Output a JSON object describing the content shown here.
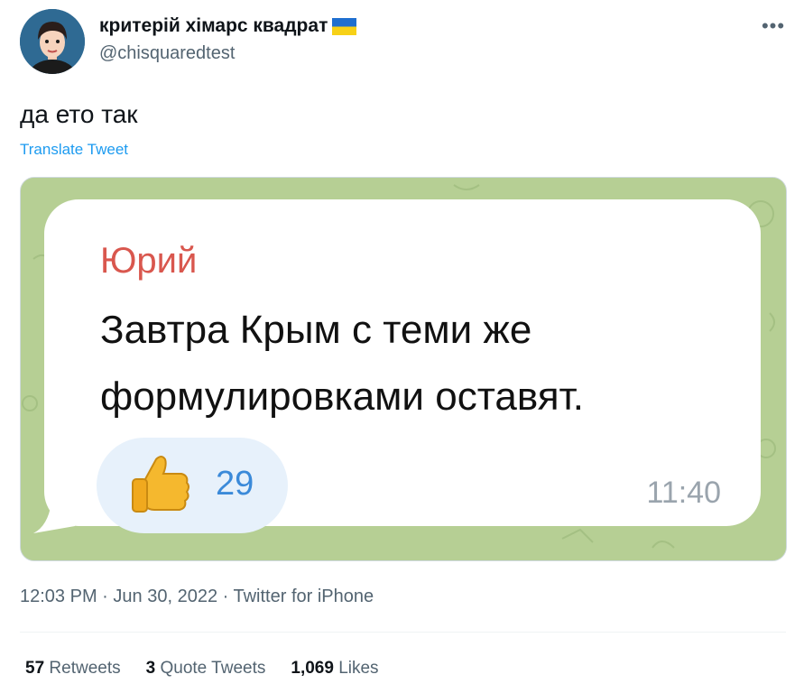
{
  "author": {
    "display_name": "критерій хімарс квадрат",
    "handle": "@chisquaredtest",
    "avatar_icon": "avatar-icon",
    "flag_icon": "ukraine-flag-icon"
  },
  "more_label": "•••",
  "tweet": {
    "text": "да ето так",
    "translate_label": "Translate Tweet"
  },
  "media": {
    "sender": "Юрий",
    "message_line_1": "Завтра Крым с теми же",
    "message_line_2": "формулировками оставят.",
    "reaction_icon": "thumbs-up-icon",
    "reaction_count": "29",
    "time": "11:40",
    "colors": {
      "chat_background": "#b6cf94",
      "sender": "#d9574e",
      "reaction_pill": "#e7f1fb",
      "reaction_count": "#3b8ad9"
    }
  },
  "meta": {
    "time": "12:03 PM",
    "date": "Jun 30, 2022",
    "source": "Twitter for iPhone",
    "separator": "·"
  },
  "stats": {
    "retweets_count": "57",
    "retweets_label": "Retweets",
    "quotes_count": "3",
    "quotes_label": "Quote Tweets",
    "likes_count": "1,069",
    "likes_label": "Likes"
  },
  "colors": {
    "link": "#1d9bf0",
    "secondary_text": "#536471",
    "primary_text": "#0f1419"
  }
}
